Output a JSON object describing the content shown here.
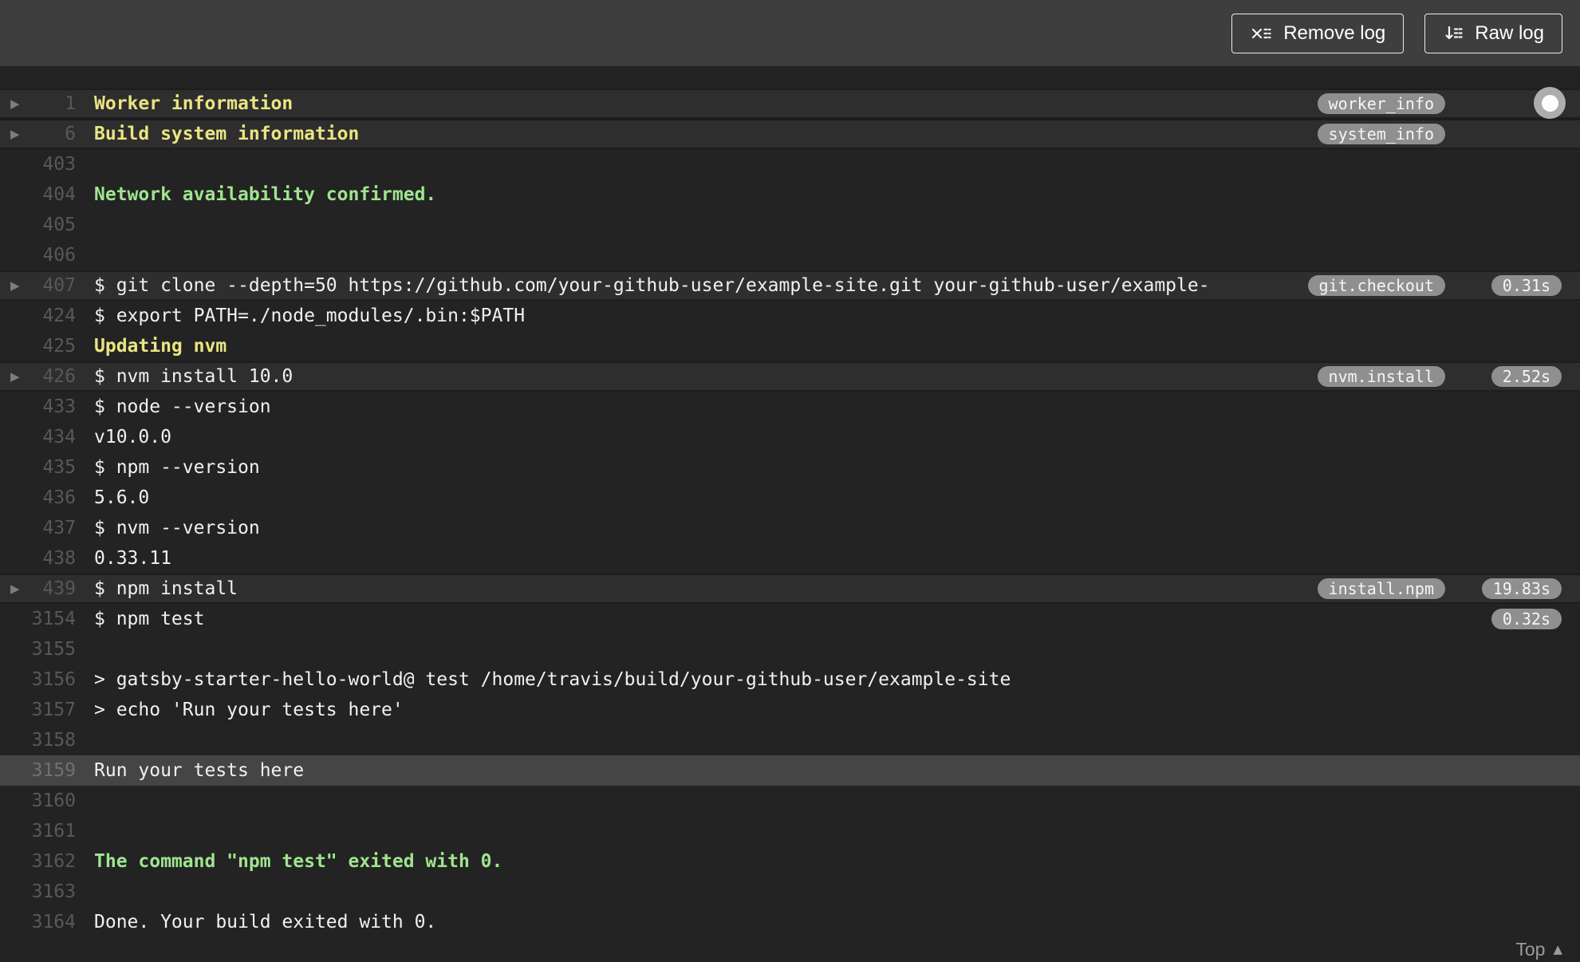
{
  "header": {
    "buttons": [
      {
        "label": "Remove log",
        "icon": "remove-log-icon"
      },
      {
        "label": "Raw log",
        "icon": "raw-log-icon"
      }
    ]
  },
  "footer": {
    "top_label": "Top"
  },
  "colors": {
    "log_background": "#232323",
    "header_background": "#3e3e3e",
    "fold_row_background": "#2e2e2e",
    "selected_row_background": "#454545",
    "yellow_text": "#eae581",
    "green_text": "#9fe58f",
    "plain_text": "#f1f1f1",
    "line_number": "#585858",
    "badge_background": "#8f8f8f"
  },
  "log": {
    "rows": [
      {
        "num": "1",
        "text": "Worker information",
        "color": "yellow",
        "fold": true,
        "badge": "worker_info"
      },
      {
        "num": "6",
        "text": "Build system information",
        "color": "yellow",
        "fold": true,
        "badge": "system_info"
      },
      {
        "num": "403",
        "text": ""
      },
      {
        "num": "404",
        "text": "Network availability confirmed.",
        "color": "green"
      },
      {
        "num": "405",
        "text": ""
      },
      {
        "num": "406",
        "text": ""
      },
      {
        "num": "407",
        "text": "$ git clone --depth=50 https://github.com/your-github-user/example-site.git your-github-user/example-",
        "fold": true,
        "badge": "git.checkout",
        "time": "0.31s"
      },
      {
        "num": "424",
        "text": "$ export PATH=./node_modules/.bin:$PATH"
      },
      {
        "num": "425",
        "text": "Updating nvm",
        "color": "yellow"
      },
      {
        "num": "426",
        "text": "$ nvm install 10.0",
        "fold": true,
        "badge": "nvm.install",
        "time": "2.52s"
      },
      {
        "num": "433",
        "text": "$ node --version"
      },
      {
        "num": "434",
        "text": "v10.0.0"
      },
      {
        "num": "435",
        "text": "$ npm --version"
      },
      {
        "num": "436",
        "text": "5.6.0"
      },
      {
        "num": "437",
        "text": "$ nvm --version"
      },
      {
        "num": "438",
        "text": "0.33.11"
      },
      {
        "num": "439",
        "text": "$ npm install",
        "fold": true,
        "badge": "install.npm",
        "time": "19.83s"
      },
      {
        "num": "3154",
        "text": "$ npm test",
        "time": "0.32s"
      },
      {
        "num": "3155",
        "text": ""
      },
      {
        "num": "3156",
        "text": "> gatsby-starter-hello-world@ test /home/travis/build/your-github-user/example-site"
      },
      {
        "num": "3157",
        "text": "> echo 'Run your tests here'"
      },
      {
        "num": "3158",
        "text": ""
      },
      {
        "num": "3159",
        "text": "Run your tests here",
        "selected": true
      },
      {
        "num": "3160",
        "text": ""
      },
      {
        "num": "3161",
        "text": ""
      },
      {
        "num": "3162",
        "text": "The command \"npm test\" exited with 0.",
        "color": "green"
      },
      {
        "num": "3163",
        "text": ""
      },
      {
        "num": "3164",
        "text": "Done. Your build exited with 0."
      }
    ]
  }
}
